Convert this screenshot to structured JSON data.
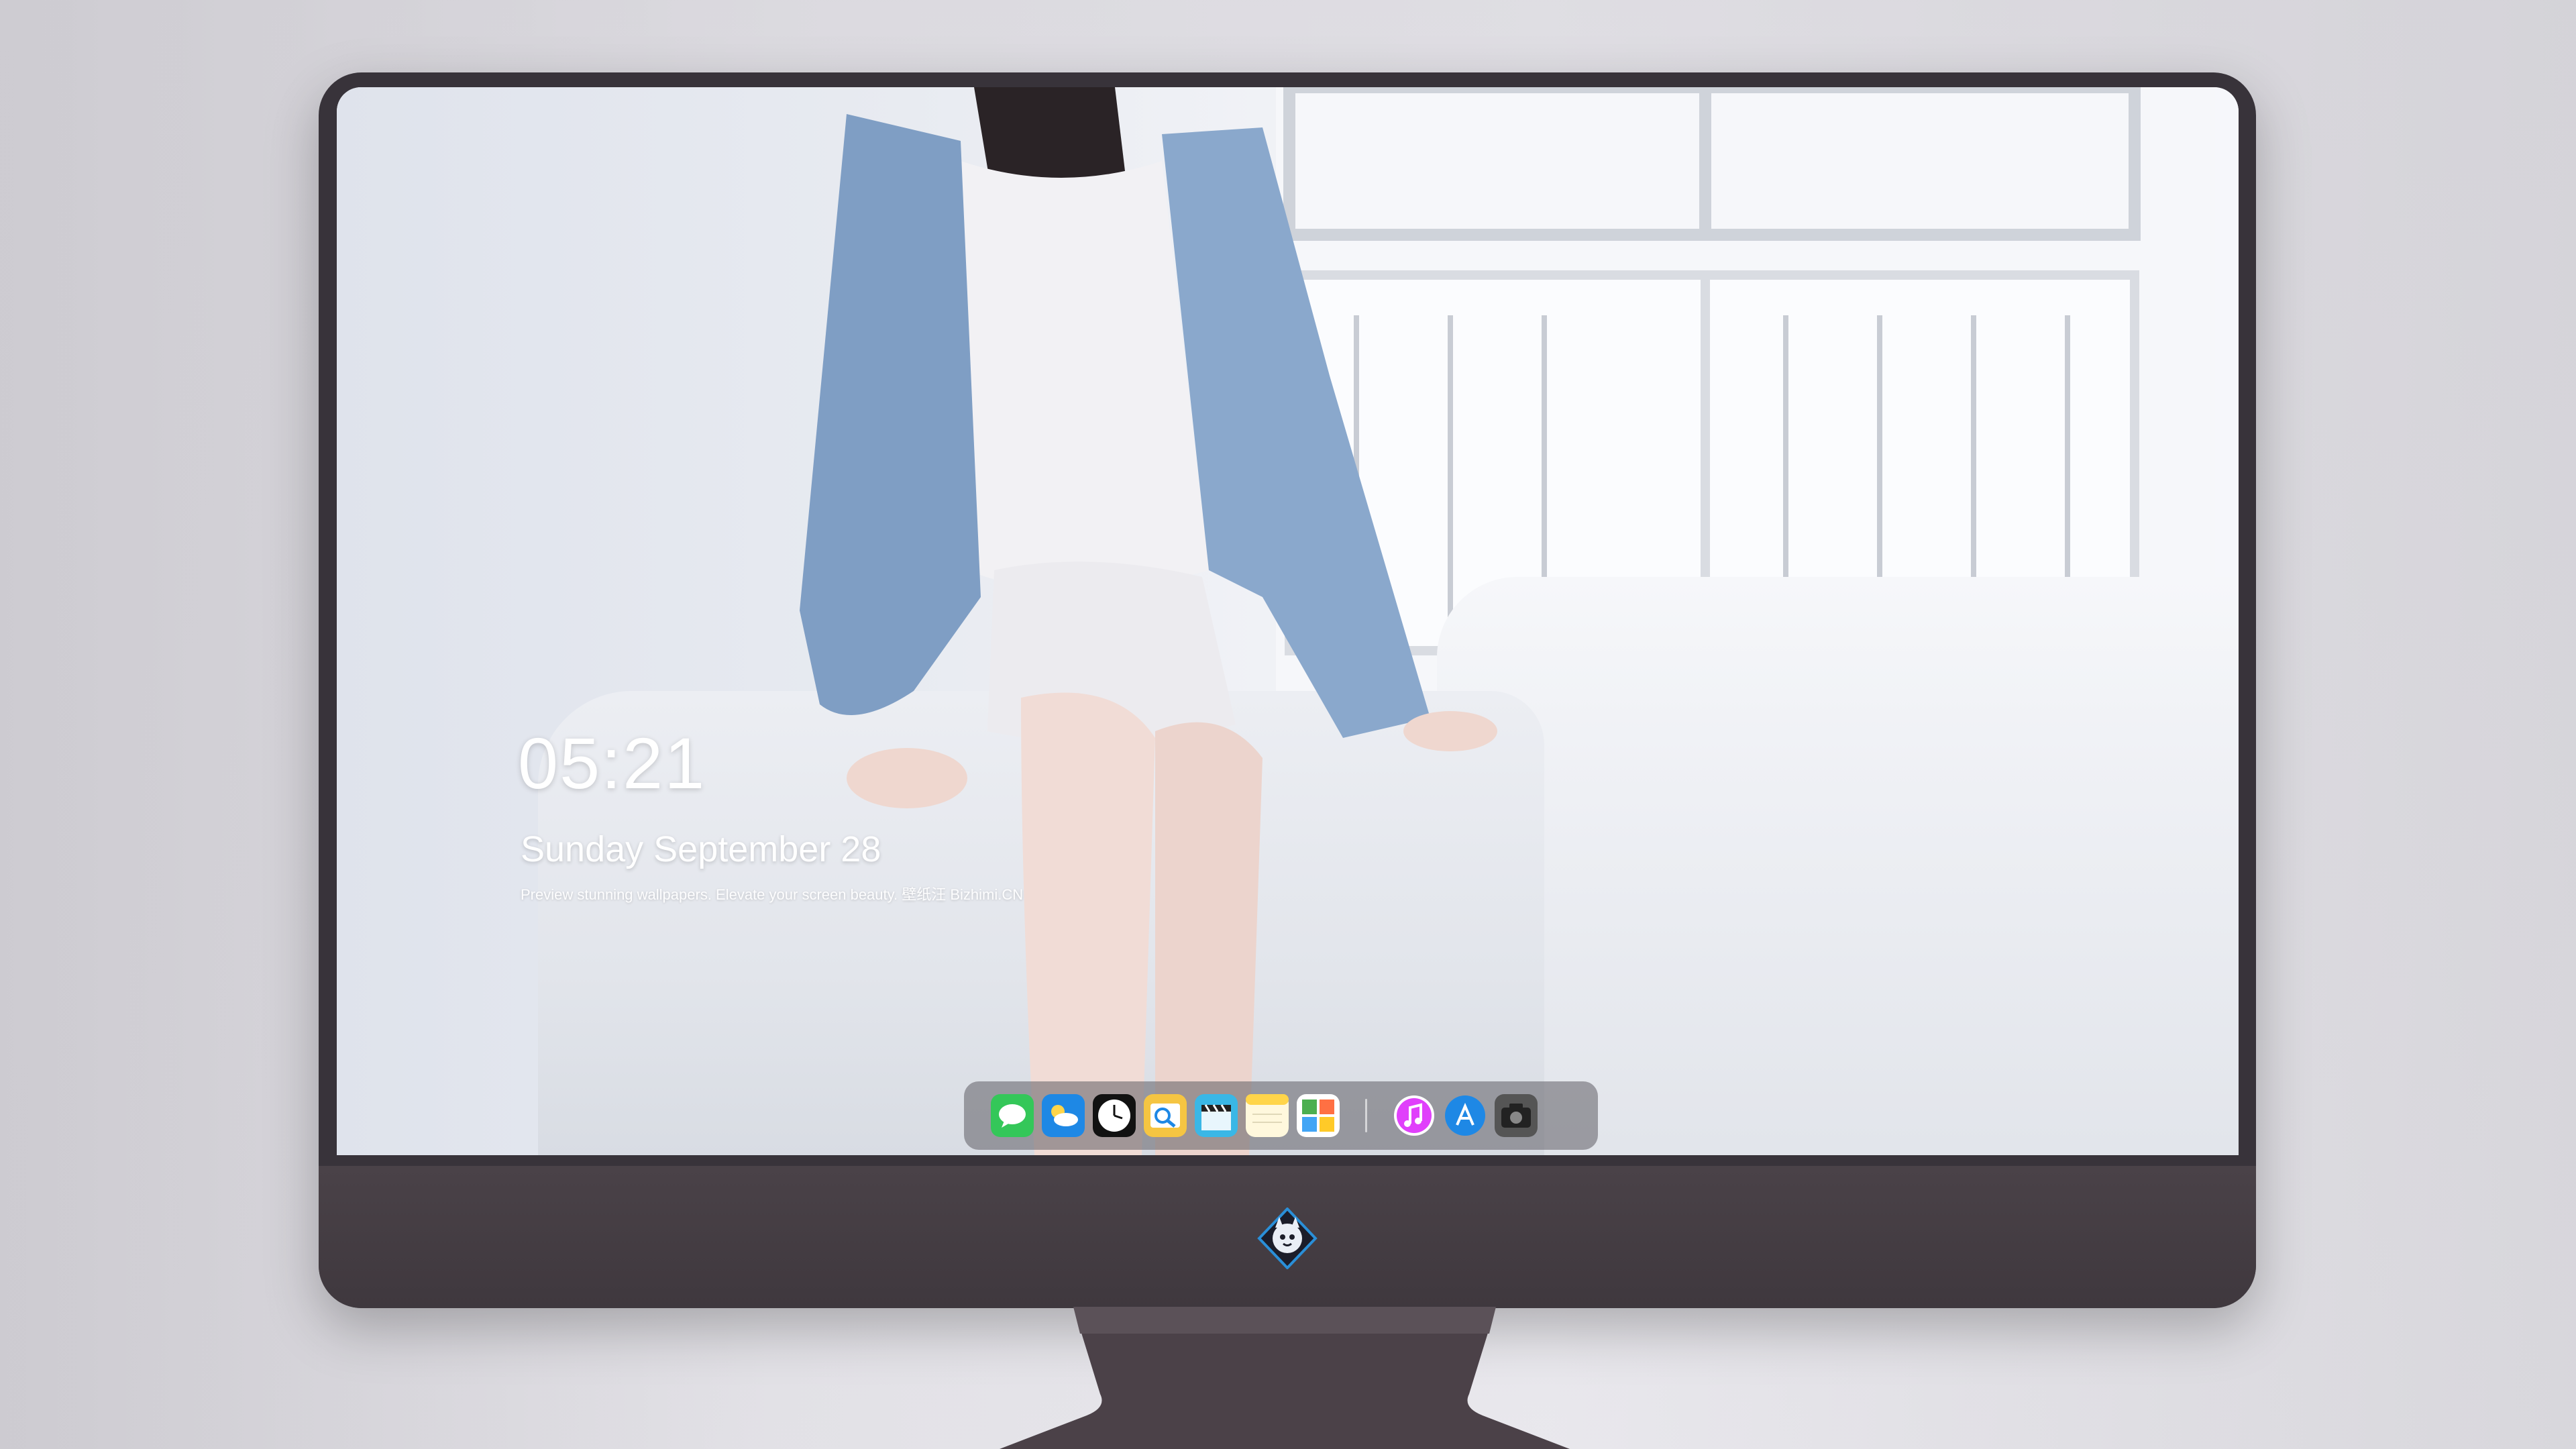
{
  "lockscreen": {
    "time": "05:21",
    "date": "Sunday September  28",
    "tagline": "Preview stunning wallpapers. Elevate your screen beauty.  壁纸汪    Bizhimi.CN"
  },
  "dock": {
    "items": [
      {
        "name": "messages-icon",
        "color": "#34c759"
      },
      {
        "name": "weather-icon",
        "color": "#1e88e5"
      },
      {
        "name": "clock-icon",
        "color": "#111111"
      },
      {
        "name": "preview-icon",
        "color": "#f5c542"
      },
      {
        "name": "clapper-icon",
        "color": "#3ab7e6"
      },
      {
        "name": "notes-icon",
        "color": "#ffd54a"
      },
      {
        "name": "photo-board-icon",
        "color": "#ffffff"
      },
      {
        "name": "music-icon",
        "color": "#e040fb"
      },
      {
        "name": "app-store-icon",
        "color": "#1e88e5"
      },
      {
        "name": "camera-icon",
        "color": "#555555"
      }
    ]
  },
  "brand": {
    "logo": "fox-mascot-logo",
    "accent": "#2a8fd8"
  }
}
